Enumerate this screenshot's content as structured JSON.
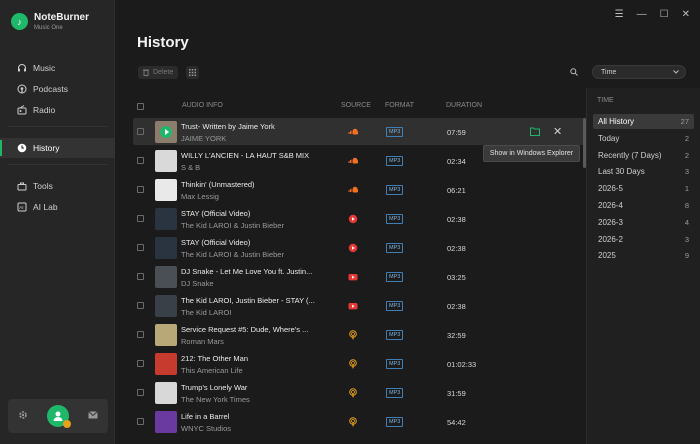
{
  "app": {
    "name": "NoteBurner",
    "subtitle": "Music One",
    "logo_letter": "♪"
  },
  "window_controls": [
    "☰",
    "—",
    "☐",
    "✕"
  ],
  "nav": [
    {
      "label": "Music",
      "icon": "headphones-icon"
    },
    {
      "label": "Podcasts",
      "icon": "podcast-icon"
    },
    {
      "label": "Radio",
      "icon": "radio-icon"
    },
    {
      "label": "History",
      "icon": "clock-icon",
      "active": true
    },
    {
      "label": "Tools",
      "icon": "toolbox-icon"
    },
    {
      "label": "AI Lab",
      "icon": "ai-icon"
    }
  ],
  "page": {
    "title": "History"
  },
  "toolbar": {
    "delete_label": "Delete",
    "sort_select": "Time"
  },
  "table": {
    "headers": {
      "audio_info": "AUDIO INFO",
      "source": "SOURCE",
      "format": "FORMAT",
      "duration": "DURATION"
    },
    "rows": [
      {
        "title": "Trust- Written by Jaime York",
        "artist": "JAIME YORK",
        "source": "soundcloud",
        "format": "MP3",
        "duration": "07:59",
        "thumb": "#8a7d6b"
      },
      {
        "title": "WILLY L'ANCIEN - LA HAUT S&B MIX",
        "artist": "S & B",
        "source": "soundcloud",
        "format": "MP3",
        "duration": "02:34",
        "thumb": "#d9d9d9"
      },
      {
        "title": "Thinkin' (Unmastered)",
        "artist": "Max Lessig",
        "source": "soundcloud",
        "format": "MP3",
        "duration": "06:21",
        "thumb": "#e9e9e9"
      },
      {
        "title": "STAY (Official Video)",
        "artist": "The Kid LAROI & Justin Bieber",
        "source": "youtube-music",
        "format": "MP3",
        "duration": "02:38",
        "thumb": "#2a3440"
      },
      {
        "title": "STAY (Official Video)",
        "artist": "The Kid LAROI & Justin Bieber",
        "source": "youtube-music",
        "format": "MP3",
        "duration": "02:38",
        "thumb": "#2a3440"
      },
      {
        "title": "DJ Snake - Let Me Love You ft. Justin...",
        "artist": "DJ Snake",
        "source": "youtube",
        "format": "MP3",
        "duration": "03:25",
        "thumb": "#4a4f55"
      },
      {
        "title": "The Kid LAROI, Justin Bieber - STAY (...",
        "artist": "The Kid LAROI",
        "source": "youtube",
        "format": "MP3",
        "duration": "02:38",
        "thumb": "#3a4048"
      },
      {
        "title": "Service Request #5: Dude, Where's ...",
        "artist": "Roman Mars",
        "source": "podcast",
        "format": "MP3",
        "duration": "32:59",
        "thumb": "#b8a878"
      },
      {
        "title": "212: The Other Man",
        "artist": "This American Life",
        "source": "podcast",
        "format": "MP3",
        "duration": "01:02:33",
        "thumb": "#c73a2e"
      },
      {
        "title": "Trump’s Lonely War",
        "artist": "The New York Times",
        "source": "podcast",
        "format": "MP3",
        "duration": "31:59",
        "thumb": "#d8d8d8"
      },
      {
        "title": "Life in a Barrel",
        "artist": "WNYC Studios",
        "source": "podcast",
        "format": "MP3",
        "duration": "54:42",
        "thumb": "#6a3aa0"
      }
    ]
  },
  "row_actions": {
    "tooltip": "Show in Windows Explorer"
  },
  "filter": {
    "heading": "TIME",
    "items": [
      {
        "label": "All History",
        "count": "27",
        "active": true
      },
      {
        "label": "Today",
        "count": "2"
      },
      {
        "label": "Recently (7 Days)",
        "count": "2"
      },
      {
        "label": "Last 30 Days",
        "count": "3"
      },
      {
        "label": "2026-5",
        "count": "1"
      },
      {
        "label": "2026-4",
        "count": "8"
      },
      {
        "label": "2026-3",
        "count": "4"
      },
      {
        "label": "2026-2",
        "count": "3"
      },
      {
        "label": "2025",
        "count": "9"
      }
    ]
  },
  "colors": {
    "accent": "#1fb86b",
    "soundcloud": "#f26f23",
    "youtube": "#e53935",
    "podcast": "#e8a21a"
  }
}
